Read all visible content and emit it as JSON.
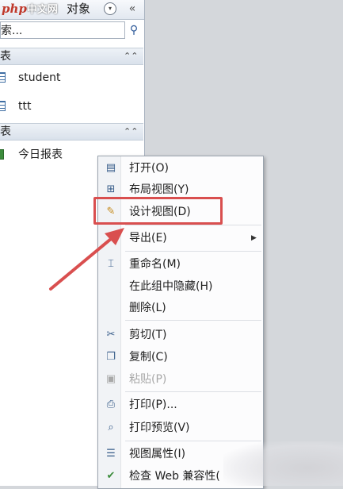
{
  "nav": {
    "logo_latin": "php",
    "logo_cn": "中文网",
    "title": "对象",
    "search_placeholder": "索...",
    "groups": [
      {
        "label": "表",
        "items": [
          "student",
          "ttt"
        ]
      },
      {
        "label": "表",
        "items": [
          "今日报表"
        ]
      }
    ]
  },
  "context_menu": {
    "items": [
      {
        "label": "打开(O)",
        "icon": "open-icon"
      },
      {
        "label": "布局视图(Y)",
        "icon": "layout-view-icon"
      },
      {
        "label": "设计视图(D)",
        "icon": "design-view-icon"
      },
      {
        "label": "导出(E)",
        "icon": "",
        "submenu": true
      },
      {
        "label": "重命名(M)",
        "icon": "rename-icon"
      },
      {
        "label": "在此组中隐藏(H)",
        "icon": ""
      },
      {
        "label": "删除(L)",
        "icon": ""
      },
      {
        "label": "剪切(T)",
        "icon": "cut-icon"
      },
      {
        "label": "复制(C)",
        "icon": "copy-icon"
      },
      {
        "label": "粘贴(P)",
        "icon": "paste-icon",
        "disabled": true
      },
      {
        "label": "打印(P)...",
        "icon": "print-icon"
      },
      {
        "label": "打印预览(V)",
        "icon": "print-preview-icon"
      },
      {
        "label": "视图属性(I)",
        "icon": "properties-icon"
      },
      {
        "label": "检查 Web 兼容性(",
        "icon": "check-icon"
      }
    ]
  },
  "colors": {
    "highlight": "#d94f4f",
    "arrow": "#d94f4f"
  }
}
